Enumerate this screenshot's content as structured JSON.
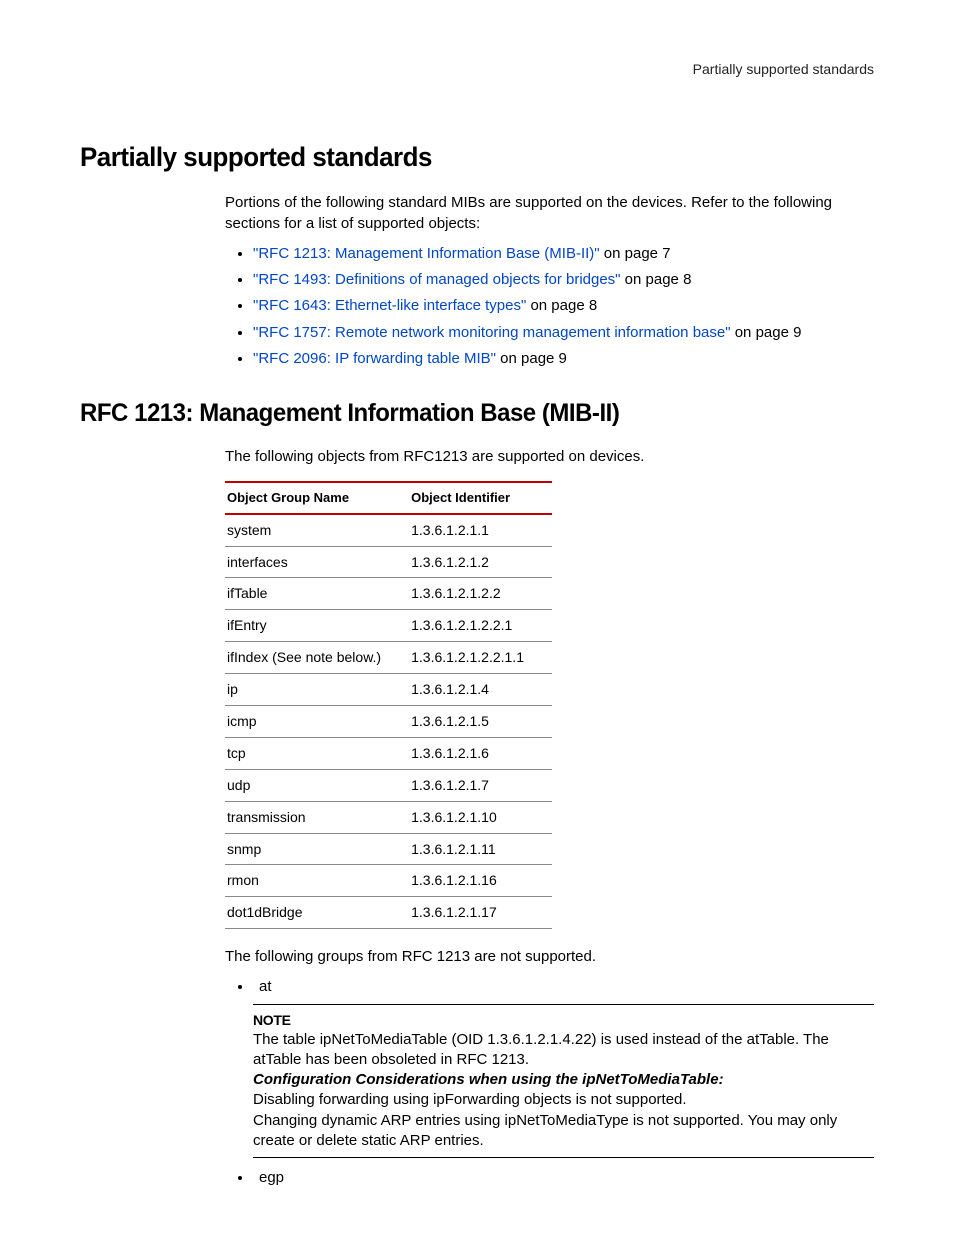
{
  "header": {
    "label": "Partially supported standards"
  },
  "h1": "Partially supported standards",
  "intro1": "Portions of the following standard MIBs are supported on the devices. Refer to the following sections for a list of supported objects:",
  "links": [
    {
      "text": "\"RFC 1213: Management Information Base (MIB-II)\"",
      "after": " on page 7"
    },
    {
      "text": "\"RFC 1493: Definitions of managed objects for bridges\"",
      "after": " on page 8"
    },
    {
      "text": "\"RFC 1643: Ethernet-like interface types\"",
      "after": " on page 8"
    },
    {
      "text": "\"RFC 1757: Remote network monitoring management information base\"",
      "after": " on page 9"
    },
    {
      "text": "\"RFC 2096: IP forwarding table MIB\"",
      "after": " on page 9"
    }
  ],
  "h2": "RFC 1213: Management Information Base (MIB-II)",
  "intro2": "The following objects from RFC1213 are supported on devices.",
  "table": {
    "headers": [
      "Object Group Name",
      "Object Identifier"
    ],
    "rows": [
      [
        "system",
        "1.3.6.1.2.1.1"
      ],
      [
        "interfaces",
        "1.3.6.1.2.1.2"
      ],
      [
        "ifTable",
        "1.3.6.1.2.1.2.2"
      ],
      [
        "ifEntry",
        "1.3.6.1.2.1.2.2.1"
      ],
      [
        "ifIndex (See note below.)",
        "1.3.6.1.2.1.2.2.1.1"
      ],
      [
        "ip",
        "1.3.6.1.2.1.4"
      ],
      [
        "icmp",
        "1.3.6.1.2.1.5"
      ],
      [
        "tcp",
        "1.3.6.1.2.1.6"
      ],
      [
        "udp",
        "1.3.6.1.2.1.7"
      ],
      [
        "transmission",
        "1.3.6.1.2.1.10"
      ],
      [
        "snmp",
        "1.3.6.1.2.1.11"
      ],
      [
        "rmon",
        "1.3.6.1.2.1.16"
      ],
      [
        "dot1dBridge",
        "1.3.6.1.2.1.17"
      ]
    ]
  },
  "intro3": "The following groups from RFC 1213 are not supported.",
  "unsupported": {
    "item1": "at",
    "item2": "egp"
  },
  "note": {
    "title": "NOTE",
    "line1": "The table ipNetToMediaTable (OID 1.3.6.1.2.1.4.22) is used instead of the atTable. The atTable has been obsoleted in RFC 1213.",
    "sub": "Configuration Considerations when using the ipNetToMediaTable:",
    "line2": "Disabling forwarding using ipForwarding objects is not supported.",
    "line3": "Changing dynamic ARP entries using ipNetToMediaType is not supported. You may only create or delete static ARP entries."
  }
}
